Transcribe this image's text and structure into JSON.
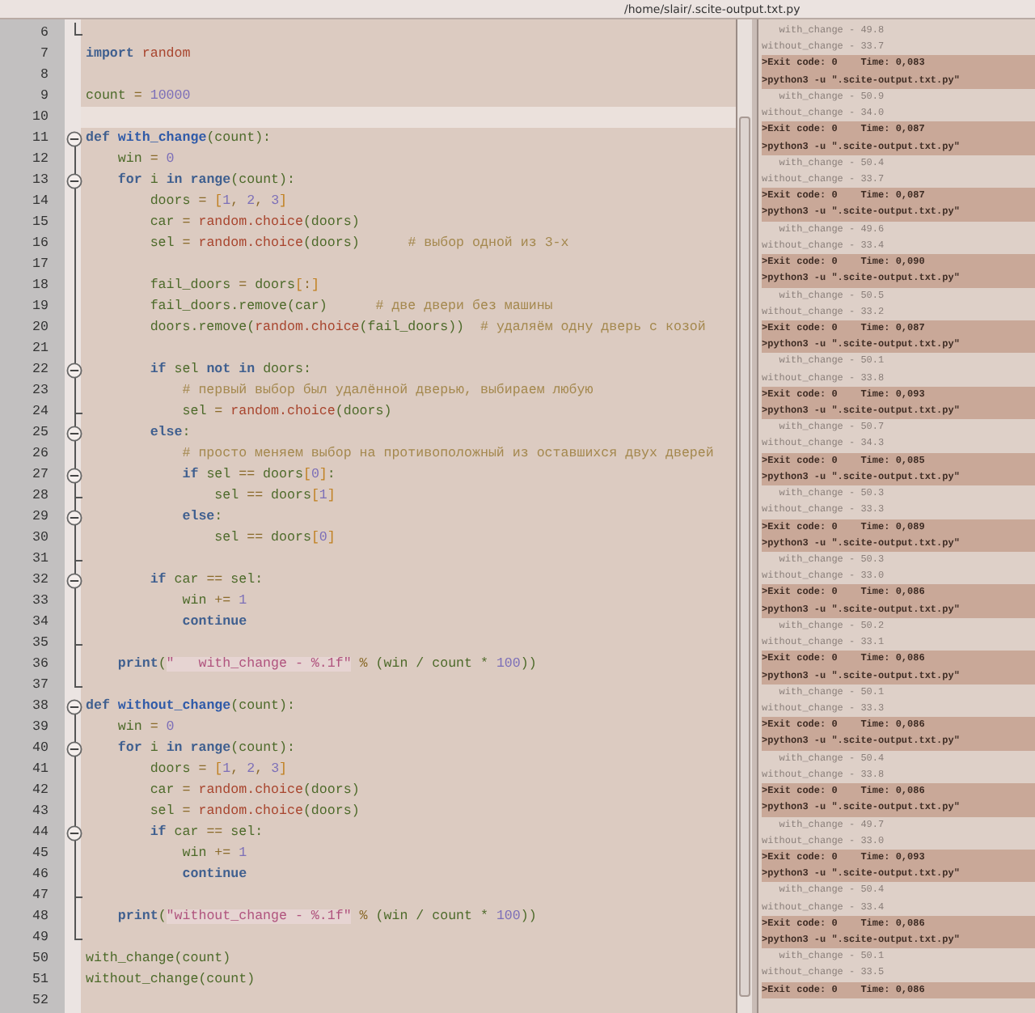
{
  "window": {
    "title": "/home/slair/.scite-output.txt.py"
  },
  "editor": {
    "lines": [
      {
        "number": "6",
        "kind": "fold_last",
        "current": false
      },
      {
        "number": "7",
        "kind": "plain",
        "current": false,
        "tokens": [
          {
            "kind": "kw",
            "text": "import "
          },
          {
            "kind": "mod",
            "text": "random"
          }
        ]
      },
      {
        "number": "8",
        "kind": "plain",
        "current": false
      },
      {
        "number": "9",
        "kind": "plain",
        "current": false,
        "tokens": [
          {
            "kind": "id",
            "text": "count"
          },
          {
            "kind": "op",
            "text": " = "
          },
          {
            "kind": "num",
            "text": "10000"
          }
        ]
      },
      {
        "number": "10",
        "kind": "plain",
        "current": true
      },
      {
        "number": "11",
        "kind": "fold_start",
        "current": false,
        "tokens": [
          {
            "kind": "kw",
            "text": "def "
          },
          {
            "kind": "fn",
            "text": "with_change"
          },
          {
            "kind": "id",
            "text": "(count):"
          }
        ]
      },
      {
        "number": "12",
        "kind": "fold_body",
        "current": false,
        "tokens": [
          {
            "kind": "id",
            "text": "    win"
          },
          {
            "kind": "op",
            "text": " = "
          },
          {
            "kind": "num",
            "text": "0"
          }
        ]
      },
      {
        "number": "13",
        "kind": "fold_start",
        "current": false,
        "tokens": [
          {
            "kind": "kw",
            "text": "    for "
          },
          {
            "kind": "id",
            "text": "i "
          },
          {
            "kind": "kw",
            "text": "in range"
          },
          {
            "kind": "id",
            "text": "(count):"
          }
        ]
      },
      {
        "number": "14",
        "kind": "fold_body",
        "current": false,
        "tokens": [
          {
            "kind": "id",
            "text": "        doors"
          },
          {
            "kind": "op",
            "text": " = "
          },
          {
            "kind": "br",
            "text": "["
          },
          {
            "kind": "num",
            "text": "1"
          },
          {
            "kind": "op",
            "text": ", "
          },
          {
            "kind": "num",
            "text": "2"
          },
          {
            "kind": "op",
            "text": ", "
          },
          {
            "kind": "num",
            "text": "3"
          },
          {
            "kind": "br",
            "text": "]"
          }
        ]
      },
      {
        "number": "15",
        "kind": "fold_body",
        "current": false,
        "tokens": [
          {
            "kind": "id",
            "text": "        car"
          },
          {
            "kind": "op",
            "text": " = "
          },
          {
            "kind": "mod",
            "text": "random.choice"
          },
          {
            "kind": "id",
            "text": "(doors)"
          }
        ]
      },
      {
        "number": "16",
        "kind": "fold_body",
        "current": false,
        "tokens": [
          {
            "kind": "id",
            "text": "        sel"
          },
          {
            "kind": "op",
            "text": " = "
          },
          {
            "kind": "mod",
            "text": "random.choice"
          },
          {
            "kind": "id",
            "text": "(doors)      "
          },
          {
            "kind": "com",
            "text": "# выбор одной из 3-х"
          }
        ]
      },
      {
        "number": "17",
        "kind": "fold_body",
        "current": false
      },
      {
        "number": "18",
        "kind": "fold_body",
        "current": false,
        "tokens": [
          {
            "kind": "id",
            "text": "        fail_doors"
          },
          {
            "kind": "op",
            "text": " = "
          },
          {
            "kind": "id",
            "text": "doors"
          },
          {
            "kind": "br",
            "text": "["
          },
          {
            "kind": "op",
            "text": ":"
          },
          {
            "kind": "br",
            "text": "]"
          }
        ]
      },
      {
        "number": "19",
        "kind": "fold_body",
        "current": false,
        "tokens": [
          {
            "kind": "id",
            "text": "        fail_doors.remove(car)      "
          },
          {
            "kind": "com",
            "text": "# две двери без машины"
          }
        ]
      },
      {
        "number": "20",
        "kind": "fold_body",
        "current": false,
        "tokens": [
          {
            "kind": "id",
            "text": "        doors.remove("
          },
          {
            "kind": "mod",
            "text": "random.choice"
          },
          {
            "kind": "id",
            "text": "(fail_doors))  "
          },
          {
            "kind": "com",
            "text": "# удаляём одну дверь с козой"
          }
        ]
      },
      {
        "number": "21",
        "kind": "fold_body",
        "current": false
      },
      {
        "number": "22",
        "kind": "fold_start",
        "current": false,
        "tokens": [
          {
            "kind": "kw",
            "text": "        if "
          },
          {
            "kind": "id",
            "text": "sel "
          },
          {
            "kind": "kw",
            "text": "not in "
          },
          {
            "kind": "id",
            "text": "doors:"
          }
        ]
      },
      {
        "number": "23",
        "kind": "fold_body",
        "current": false,
        "tokens": [
          {
            "kind": "com",
            "text": "            # первый выбор был удалённой дверью, выбираем любую"
          }
        ]
      },
      {
        "number": "24",
        "kind": "fold_end",
        "current": false,
        "tokens": [
          {
            "kind": "id",
            "text": "            sel"
          },
          {
            "kind": "op",
            "text": " = "
          },
          {
            "kind": "mod",
            "text": "random.choice"
          },
          {
            "kind": "id",
            "text": "(doors)"
          }
        ]
      },
      {
        "number": "25",
        "kind": "fold_start",
        "current": false,
        "tokens": [
          {
            "kind": "kw",
            "text": "        else"
          },
          {
            "kind": "id",
            "text": ":"
          }
        ]
      },
      {
        "number": "26",
        "kind": "fold_body",
        "current": false,
        "tokens": [
          {
            "kind": "com",
            "text": "            # просто меняем выбор на противоположный из оставшихся двух дверей"
          }
        ]
      },
      {
        "number": "27",
        "kind": "fold_start",
        "current": false,
        "tokens": [
          {
            "kind": "kw",
            "text": "            if "
          },
          {
            "kind": "id",
            "text": "sel "
          },
          {
            "kind": "op",
            "text": "== "
          },
          {
            "kind": "id",
            "text": "doors"
          },
          {
            "kind": "br",
            "text": "["
          },
          {
            "kind": "num",
            "text": "0"
          },
          {
            "kind": "br",
            "text": "]"
          },
          {
            "kind": "id",
            "text": ":"
          }
        ]
      },
      {
        "number": "28",
        "kind": "fold_end",
        "current": false,
        "tokens": [
          {
            "kind": "id",
            "text": "                sel "
          },
          {
            "kind": "op",
            "text": "== "
          },
          {
            "kind": "id",
            "text": "doors"
          },
          {
            "kind": "br",
            "text": "["
          },
          {
            "kind": "num",
            "text": "1"
          },
          {
            "kind": "br",
            "text": "]"
          }
        ]
      },
      {
        "number": "29",
        "kind": "fold_start",
        "current": false,
        "tokens": [
          {
            "kind": "kw",
            "text": "            else"
          },
          {
            "kind": "id",
            "text": ":"
          }
        ]
      },
      {
        "number": "30",
        "kind": "fold_body",
        "current": false,
        "tokens": [
          {
            "kind": "id",
            "text": "                sel "
          },
          {
            "kind": "op",
            "text": "== "
          },
          {
            "kind": "id",
            "text": "doors"
          },
          {
            "kind": "br",
            "text": "["
          },
          {
            "kind": "num",
            "text": "0"
          },
          {
            "kind": "br",
            "text": "]"
          }
        ]
      },
      {
        "number": "31",
        "kind": "fold_end",
        "current": false
      },
      {
        "number": "32",
        "kind": "fold_start",
        "current": false,
        "tokens": [
          {
            "kind": "kw",
            "text": "        if "
          },
          {
            "kind": "id",
            "text": "car "
          },
          {
            "kind": "op",
            "text": "== "
          },
          {
            "kind": "id",
            "text": "sel:"
          }
        ]
      },
      {
        "number": "33",
        "kind": "fold_body",
        "current": false,
        "tokens": [
          {
            "kind": "id",
            "text": "            win "
          },
          {
            "kind": "op",
            "text": "+= "
          },
          {
            "kind": "num",
            "text": "1"
          }
        ]
      },
      {
        "number": "34",
        "kind": "fold_body",
        "current": false,
        "tokens": [
          {
            "kind": "kw",
            "text": "            continue"
          }
        ]
      },
      {
        "number": "35",
        "kind": "fold_end",
        "current": false
      },
      {
        "number": "36",
        "kind": "fold_body",
        "current": false,
        "tokens": [
          {
            "kind": "kw",
            "text": "    print"
          },
          {
            "kind": "id",
            "text": "("
          },
          {
            "kind": "str",
            "text": "\"   with_change - %.1f\""
          },
          {
            "kind": "op",
            "text": " % "
          },
          {
            "kind": "id",
            "text": "(win / count * "
          },
          {
            "kind": "num",
            "text": "100"
          },
          {
            "kind": "id",
            "text": "))"
          }
        ]
      },
      {
        "number": "37",
        "kind": "fold_last",
        "current": false
      },
      {
        "number": "38",
        "kind": "fold_start",
        "current": false,
        "tokens": [
          {
            "kind": "kw",
            "text": "def "
          },
          {
            "kind": "fn",
            "text": "without_change"
          },
          {
            "kind": "id",
            "text": "(count):"
          }
        ]
      },
      {
        "number": "39",
        "kind": "fold_body",
        "current": false,
        "tokens": [
          {
            "kind": "id",
            "text": "    win"
          },
          {
            "kind": "op",
            "text": " = "
          },
          {
            "kind": "num",
            "text": "0"
          }
        ]
      },
      {
        "number": "40",
        "kind": "fold_start",
        "current": false,
        "tokens": [
          {
            "kind": "kw",
            "text": "    for "
          },
          {
            "kind": "id",
            "text": "i "
          },
          {
            "kind": "kw",
            "text": "in range"
          },
          {
            "kind": "id",
            "text": "(count):"
          }
        ]
      },
      {
        "number": "41",
        "kind": "fold_body",
        "current": false,
        "tokens": [
          {
            "kind": "id",
            "text": "        doors"
          },
          {
            "kind": "op",
            "text": " = "
          },
          {
            "kind": "br",
            "text": "["
          },
          {
            "kind": "num",
            "text": "1"
          },
          {
            "kind": "op",
            "text": ", "
          },
          {
            "kind": "num",
            "text": "2"
          },
          {
            "kind": "op",
            "text": ", "
          },
          {
            "kind": "num",
            "text": "3"
          },
          {
            "kind": "br",
            "text": "]"
          }
        ]
      },
      {
        "number": "42",
        "kind": "fold_body",
        "current": false,
        "tokens": [
          {
            "kind": "id",
            "text": "        car"
          },
          {
            "kind": "op",
            "text": " = "
          },
          {
            "kind": "mod",
            "text": "random.choice"
          },
          {
            "kind": "id",
            "text": "(doors)"
          }
        ]
      },
      {
        "number": "43",
        "kind": "fold_body",
        "current": false,
        "tokens": [
          {
            "kind": "id",
            "text": "        sel"
          },
          {
            "kind": "op",
            "text": " = "
          },
          {
            "kind": "mod",
            "text": "random.choice"
          },
          {
            "kind": "id",
            "text": "(doors)"
          }
        ]
      },
      {
        "number": "44",
        "kind": "fold_start",
        "current": false,
        "tokens": [
          {
            "kind": "kw",
            "text": "        if "
          },
          {
            "kind": "id",
            "text": "car "
          },
          {
            "kind": "op",
            "text": "== "
          },
          {
            "kind": "id",
            "text": "sel:"
          }
        ]
      },
      {
        "number": "45",
        "kind": "fold_body",
        "current": false,
        "tokens": [
          {
            "kind": "id",
            "text": "            win "
          },
          {
            "kind": "op",
            "text": "+= "
          },
          {
            "kind": "num",
            "text": "1"
          }
        ]
      },
      {
        "number": "46",
        "kind": "fold_body",
        "current": false,
        "tokens": [
          {
            "kind": "kw",
            "text": "            continue"
          }
        ]
      },
      {
        "number": "47",
        "kind": "fold_end",
        "current": false
      },
      {
        "number": "48",
        "kind": "fold_body",
        "current": false,
        "tokens": [
          {
            "kind": "kw",
            "text": "    print"
          },
          {
            "kind": "id",
            "text": "("
          },
          {
            "kind": "str",
            "text": "\"without_change - %.1f\""
          },
          {
            "kind": "op",
            "text": " % "
          },
          {
            "kind": "id",
            "text": "(win / count * "
          },
          {
            "kind": "num",
            "text": "100"
          },
          {
            "kind": "id",
            "text": "))"
          }
        ]
      },
      {
        "number": "49",
        "kind": "fold_last",
        "current": false
      },
      {
        "number": "50",
        "kind": "plain",
        "current": false,
        "tokens": [
          {
            "kind": "id",
            "text": "with_change(count)"
          }
        ]
      },
      {
        "number": "51",
        "kind": "plain",
        "current": false,
        "tokens": [
          {
            "kind": "id",
            "text": "without_change(count)"
          }
        ]
      },
      {
        "number": "52",
        "kind": "plain",
        "current": false
      }
    ]
  },
  "output": {
    "lines": [
      {
        "kind": "result",
        "text": "   with_change - 49.8"
      },
      {
        "kind": "result",
        "text": "without_change - 33.7"
      },
      {
        "kind": "exit",
        "text": ">Exit code: 0    Time: 0,083"
      },
      {
        "kind": "command",
        "text": ">python3 -u \".scite-output.txt.py\""
      },
      {
        "kind": "result",
        "text": "   with_change - 50.9"
      },
      {
        "kind": "result",
        "text": "without_change - 34.0"
      },
      {
        "kind": "exit",
        "text": ">Exit code: 0    Time: 0,087"
      },
      {
        "kind": "command",
        "text": ">python3 -u \".scite-output.txt.py\""
      },
      {
        "kind": "result",
        "text": "   with_change - 50.4"
      },
      {
        "kind": "result",
        "text": "without_change - 33.7"
      },
      {
        "kind": "exit",
        "text": ">Exit code: 0    Time: 0,087"
      },
      {
        "kind": "command",
        "text": ">python3 -u \".scite-output.txt.py\""
      },
      {
        "kind": "result",
        "text": "   with_change - 49.6"
      },
      {
        "kind": "result",
        "text": "without_change - 33.4"
      },
      {
        "kind": "exit",
        "text": ">Exit code: 0    Time: 0,090"
      },
      {
        "kind": "command",
        "text": ">python3 -u \".scite-output.txt.py\""
      },
      {
        "kind": "result",
        "text": "   with_change - 50.5"
      },
      {
        "kind": "result",
        "text": "without_change - 33.2"
      },
      {
        "kind": "exit",
        "text": ">Exit code: 0    Time: 0,087"
      },
      {
        "kind": "command",
        "text": ">python3 -u \".scite-output.txt.py\""
      },
      {
        "kind": "result",
        "text": "   with_change - 50.1"
      },
      {
        "kind": "result",
        "text": "without_change - 33.8"
      },
      {
        "kind": "exit",
        "text": ">Exit code: 0    Time: 0,093"
      },
      {
        "kind": "command",
        "text": ">python3 -u \".scite-output.txt.py\""
      },
      {
        "kind": "result",
        "text": "   with_change - 50.7"
      },
      {
        "kind": "result",
        "text": "without_change - 34.3"
      },
      {
        "kind": "exit",
        "text": ">Exit code: 0    Time: 0,085"
      },
      {
        "kind": "command",
        "text": ">python3 -u \".scite-output.txt.py\""
      },
      {
        "kind": "result",
        "text": "   with_change - 50.3"
      },
      {
        "kind": "result",
        "text": "without_change - 33.3"
      },
      {
        "kind": "exit",
        "text": ">Exit code: 0    Time: 0,089"
      },
      {
        "kind": "command",
        "text": ">python3 -u \".scite-output.txt.py\""
      },
      {
        "kind": "result",
        "text": "   with_change - 50.3"
      },
      {
        "kind": "result",
        "text": "without_change - 33.0"
      },
      {
        "kind": "exit",
        "text": ">Exit code: 0    Time: 0,086"
      },
      {
        "kind": "command",
        "text": ">python3 -u \".scite-output.txt.py\""
      },
      {
        "kind": "result",
        "text": "   with_change - 50.2"
      },
      {
        "kind": "result",
        "text": "without_change - 33.1"
      },
      {
        "kind": "exit",
        "text": ">Exit code: 0    Time: 0,086"
      },
      {
        "kind": "command",
        "text": ">python3 -u \".scite-output.txt.py\""
      },
      {
        "kind": "result",
        "text": "   with_change - 50.1"
      },
      {
        "kind": "result",
        "text": "without_change - 33.3"
      },
      {
        "kind": "exit",
        "text": ">Exit code: 0    Time: 0,086"
      },
      {
        "kind": "command",
        "text": ">python3 -u \".scite-output.txt.py\""
      },
      {
        "kind": "result",
        "text": "   with_change - 50.4"
      },
      {
        "kind": "result",
        "text": "without_change - 33.8"
      },
      {
        "kind": "exit",
        "text": ">Exit code: 0    Time: 0,086"
      },
      {
        "kind": "command",
        "text": ">python3 -u \".scite-output.txt.py\""
      },
      {
        "kind": "result",
        "text": "   with_change - 49.7"
      },
      {
        "kind": "result",
        "text": "without_change - 33.0"
      },
      {
        "kind": "exit",
        "text": ">Exit code: 0    Time: 0,093"
      },
      {
        "kind": "command",
        "text": ">python3 -u \".scite-output.txt.py\""
      },
      {
        "kind": "result",
        "text": "   with_change - 50.4"
      },
      {
        "kind": "result",
        "text": "without_change - 33.4"
      },
      {
        "kind": "exit",
        "text": ">Exit code: 0    Time: 0,086"
      },
      {
        "kind": "command",
        "text": ">python3 -u \".scite-output.txt.py\""
      },
      {
        "kind": "result",
        "text": "   with_change - 50.1"
      },
      {
        "kind": "result",
        "text": "without_change - 33.5"
      },
      {
        "kind": "exit",
        "text": ">Exit code: 0    Time: 0,086"
      }
    ]
  }
}
